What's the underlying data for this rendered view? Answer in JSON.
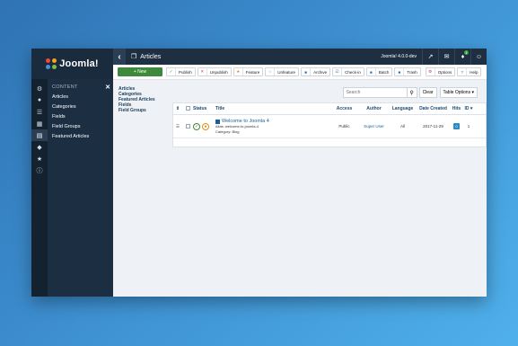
{
  "brand": {
    "logo_text": "Joomla!",
    "logo_colors": [
      "#f2483c",
      "#f9a41a",
      "#7bc143",
      "#5091cd"
    ]
  },
  "sidebar": {
    "rail_icons": [
      "dashboard-icon",
      "users-icon",
      "menus-icon",
      "content-icon",
      "articles-icon",
      "components-icon",
      "extensions-icon",
      "help-icon"
    ],
    "submenu_title": "CONTENT",
    "items": [
      {
        "label": "Articles"
      },
      {
        "label": "Categories"
      },
      {
        "label": "Fields"
      },
      {
        "label": "Field Groups"
      },
      {
        "label": "Featured Articles"
      }
    ]
  },
  "header": {
    "title": "Articles",
    "version": "Joomla! 4.0.0-dev",
    "notification_count": "1"
  },
  "toolbar": {
    "new_label": "New",
    "buttons": [
      {
        "label": "Publish",
        "icon": "check-icon",
        "color": "#3d8a3a"
      },
      {
        "label": "Unpublish",
        "icon": "times-icon",
        "color": "#c0392b"
      },
      {
        "label": "Feature",
        "icon": "star-icon",
        "color": "#e38d12"
      },
      {
        "label": "Unfeature",
        "icon": "star-outline-icon",
        "color": "#8a939c"
      },
      {
        "label": "Archive",
        "icon": "folder-icon",
        "color": "#2b6fad"
      },
      {
        "label": "Check-in",
        "icon": "checkin-icon",
        "color": "#2b6fad"
      },
      {
        "label": "Batch",
        "icon": "batch-icon",
        "color": "#2b6fad"
      },
      {
        "label": "Trash",
        "icon": "trash-icon",
        "color": "#2b6fad"
      },
      {
        "label": "Options",
        "icon": "gear-icon",
        "color": "#c0392b"
      },
      {
        "label": "Help",
        "icon": "question-icon",
        "color": "#2b6fad"
      }
    ]
  },
  "content_links": [
    "Articles",
    "Categories",
    "Featured Articles",
    "Fields",
    "Field Groups"
  ],
  "search": {
    "placeholder": "Search",
    "clear_label": "Clear",
    "options_label": "Table Options ▾"
  },
  "table": {
    "headers": {
      "status": "Status",
      "title": "Title",
      "access": "Access",
      "author": "Author",
      "language": "Language",
      "date": "Date Created",
      "hits": "Hits",
      "id": "ID ▾"
    },
    "rows": [
      {
        "title": "Welcome to Joomla 4",
        "alias": "Alias: welcome-to-joomla-4",
        "category": "Category: Blog",
        "access": "Public",
        "author": "Super User",
        "language": "All",
        "date": "2017-11-29",
        "hits": "0",
        "id": "1"
      }
    ]
  }
}
